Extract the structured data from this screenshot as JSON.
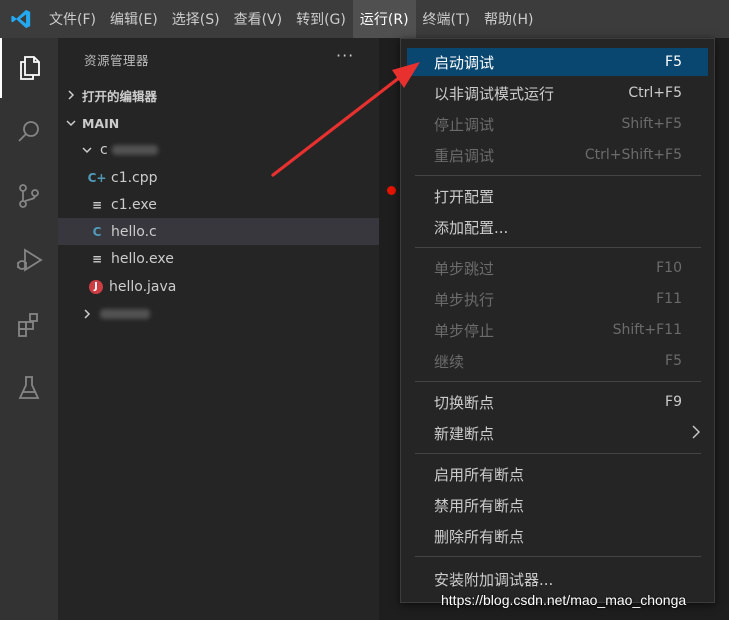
{
  "menubar": {
    "items": [
      {
        "label": "文件(F)"
      },
      {
        "label": "编辑(E)"
      },
      {
        "label": "选择(S)"
      },
      {
        "label": "查看(V)"
      },
      {
        "label": "转到(G)"
      },
      {
        "label": "运行(R)"
      },
      {
        "label": "终端(T)"
      },
      {
        "label": "帮助(H)"
      }
    ],
    "active_item": "运行(R)"
  },
  "activitybar": {
    "icons": [
      "explorer-icon",
      "search-icon",
      "source-control-icon",
      "run-debug-icon",
      "extensions-icon",
      "testing-flask-icon"
    ],
    "active": "explorer-icon"
  },
  "sidebar": {
    "title": "资源管理器",
    "more": "···",
    "open_editors": "打开的编辑器",
    "workspace": "MAIN",
    "folder_c_prefix": "c",
    "files": [
      {
        "name": "c1.cpp",
        "icon": "C+"
      },
      {
        "name": "c1.exe",
        "icon": "≡"
      },
      {
        "name": "hello.c",
        "icon": "C"
      },
      {
        "name": "hello.exe",
        "icon": "≡"
      },
      {
        "name": "hello.java",
        "icon": "J"
      }
    ],
    "selected_file": "hello.c"
  },
  "run_menu": {
    "groups": [
      [
        {
          "label": "启动调试",
          "shortcut": "F5",
          "state": "highlighted"
        },
        {
          "label": "以非调试模式运行",
          "shortcut": "Ctrl+F5",
          "state": "enabled"
        },
        {
          "label": "停止调试",
          "shortcut": "Shift+F5",
          "state": "disabled"
        },
        {
          "label": "重启调试",
          "shortcut": "Ctrl+Shift+F5",
          "state": "disabled"
        }
      ],
      [
        {
          "label": "打开配置",
          "shortcut": "",
          "state": "enabled"
        },
        {
          "label": "添加配置...",
          "shortcut": "",
          "state": "enabled"
        }
      ],
      [
        {
          "label": "单步跳过",
          "shortcut": "F10",
          "state": "disabled"
        },
        {
          "label": "单步执行",
          "shortcut": "F11",
          "state": "disabled"
        },
        {
          "label": "单步停止",
          "shortcut": "Shift+F11",
          "state": "disabled"
        },
        {
          "label": "继续",
          "shortcut": "F5",
          "state": "disabled"
        }
      ],
      [
        {
          "label": "切换断点",
          "shortcut": "F9",
          "state": "enabled"
        },
        {
          "label": "新建断点",
          "shortcut": "",
          "state": "enabled",
          "submenu": true
        }
      ],
      [
        {
          "label": "启用所有断点",
          "shortcut": "",
          "state": "enabled"
        },
        {
          "label": "禁用所有断点",
          "shortcut": "",
          "state": "enabled"
        },
        {
          "label": "删除所有断点",
          "shortcut": "",
          "state": "enabled"
        }
      ],
      [
        {
          "label": "安装附加调试器...",
          "shortcut": "",
          "state": "enabled"
        }
      ]
    ]
  },
  "watermark": "https://blog.csdn.net/mao_mao_chonga",
  "colors": {
    "titlebar": "#3c3c3c",
    "activitybar": "#333333",
    "sidebar": "#252526",
    "editor": "#1e1e1e",
    "highlight": "#094771",
    "annotation_arrow": "#e8312f",
    "vscode_blue": "#23a9f2"
  }
}
